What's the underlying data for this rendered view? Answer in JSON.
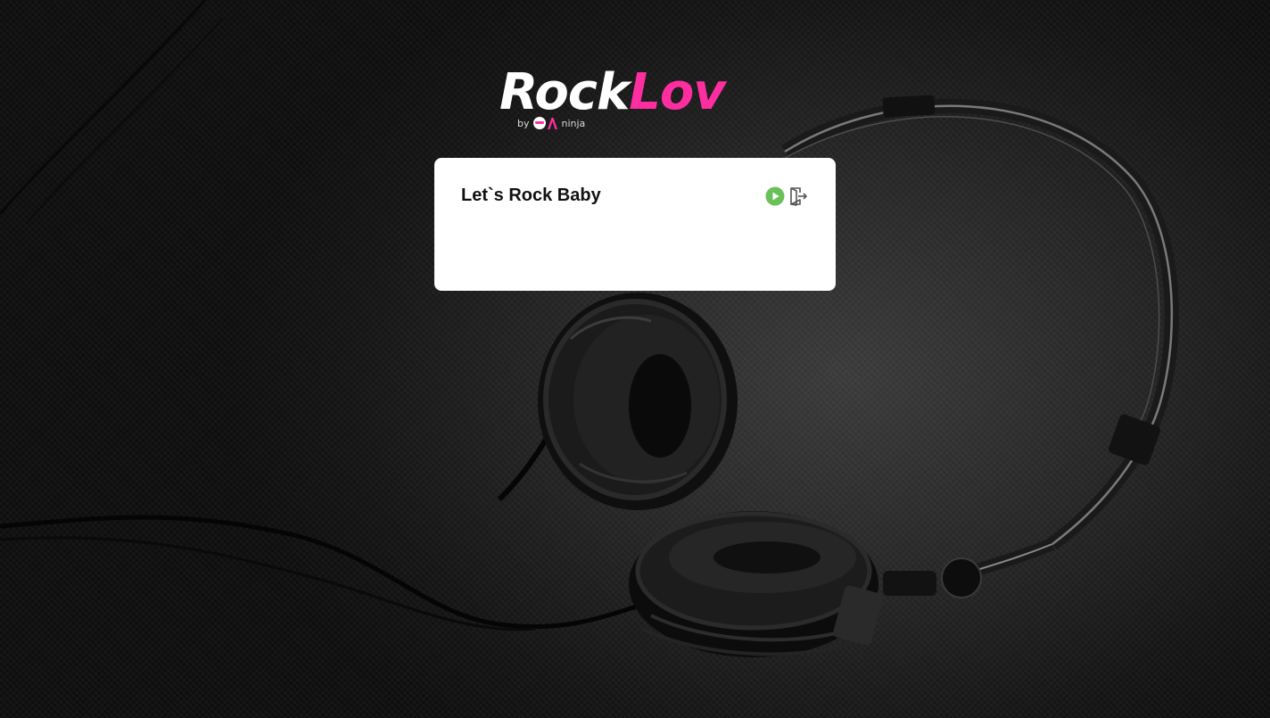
{
  "brand": {
    "name_part1": "Rock",
    "name_part2": "Lov",
    "byline_prefix": "by",
    "byline_mark": "QA",
    "byline_suffix": "ninja",
    "accent_color": "#ff2ea0"
  },
  "card": {
    "title": "Let`s Rock Baby",
    "actions": [
      {
        "icon": "play-icon",
        "color": "#6bbf59"
      },
      {
        "icon": "logout-icon",
        "color": "#555555"
      }
    ]
  }
}
